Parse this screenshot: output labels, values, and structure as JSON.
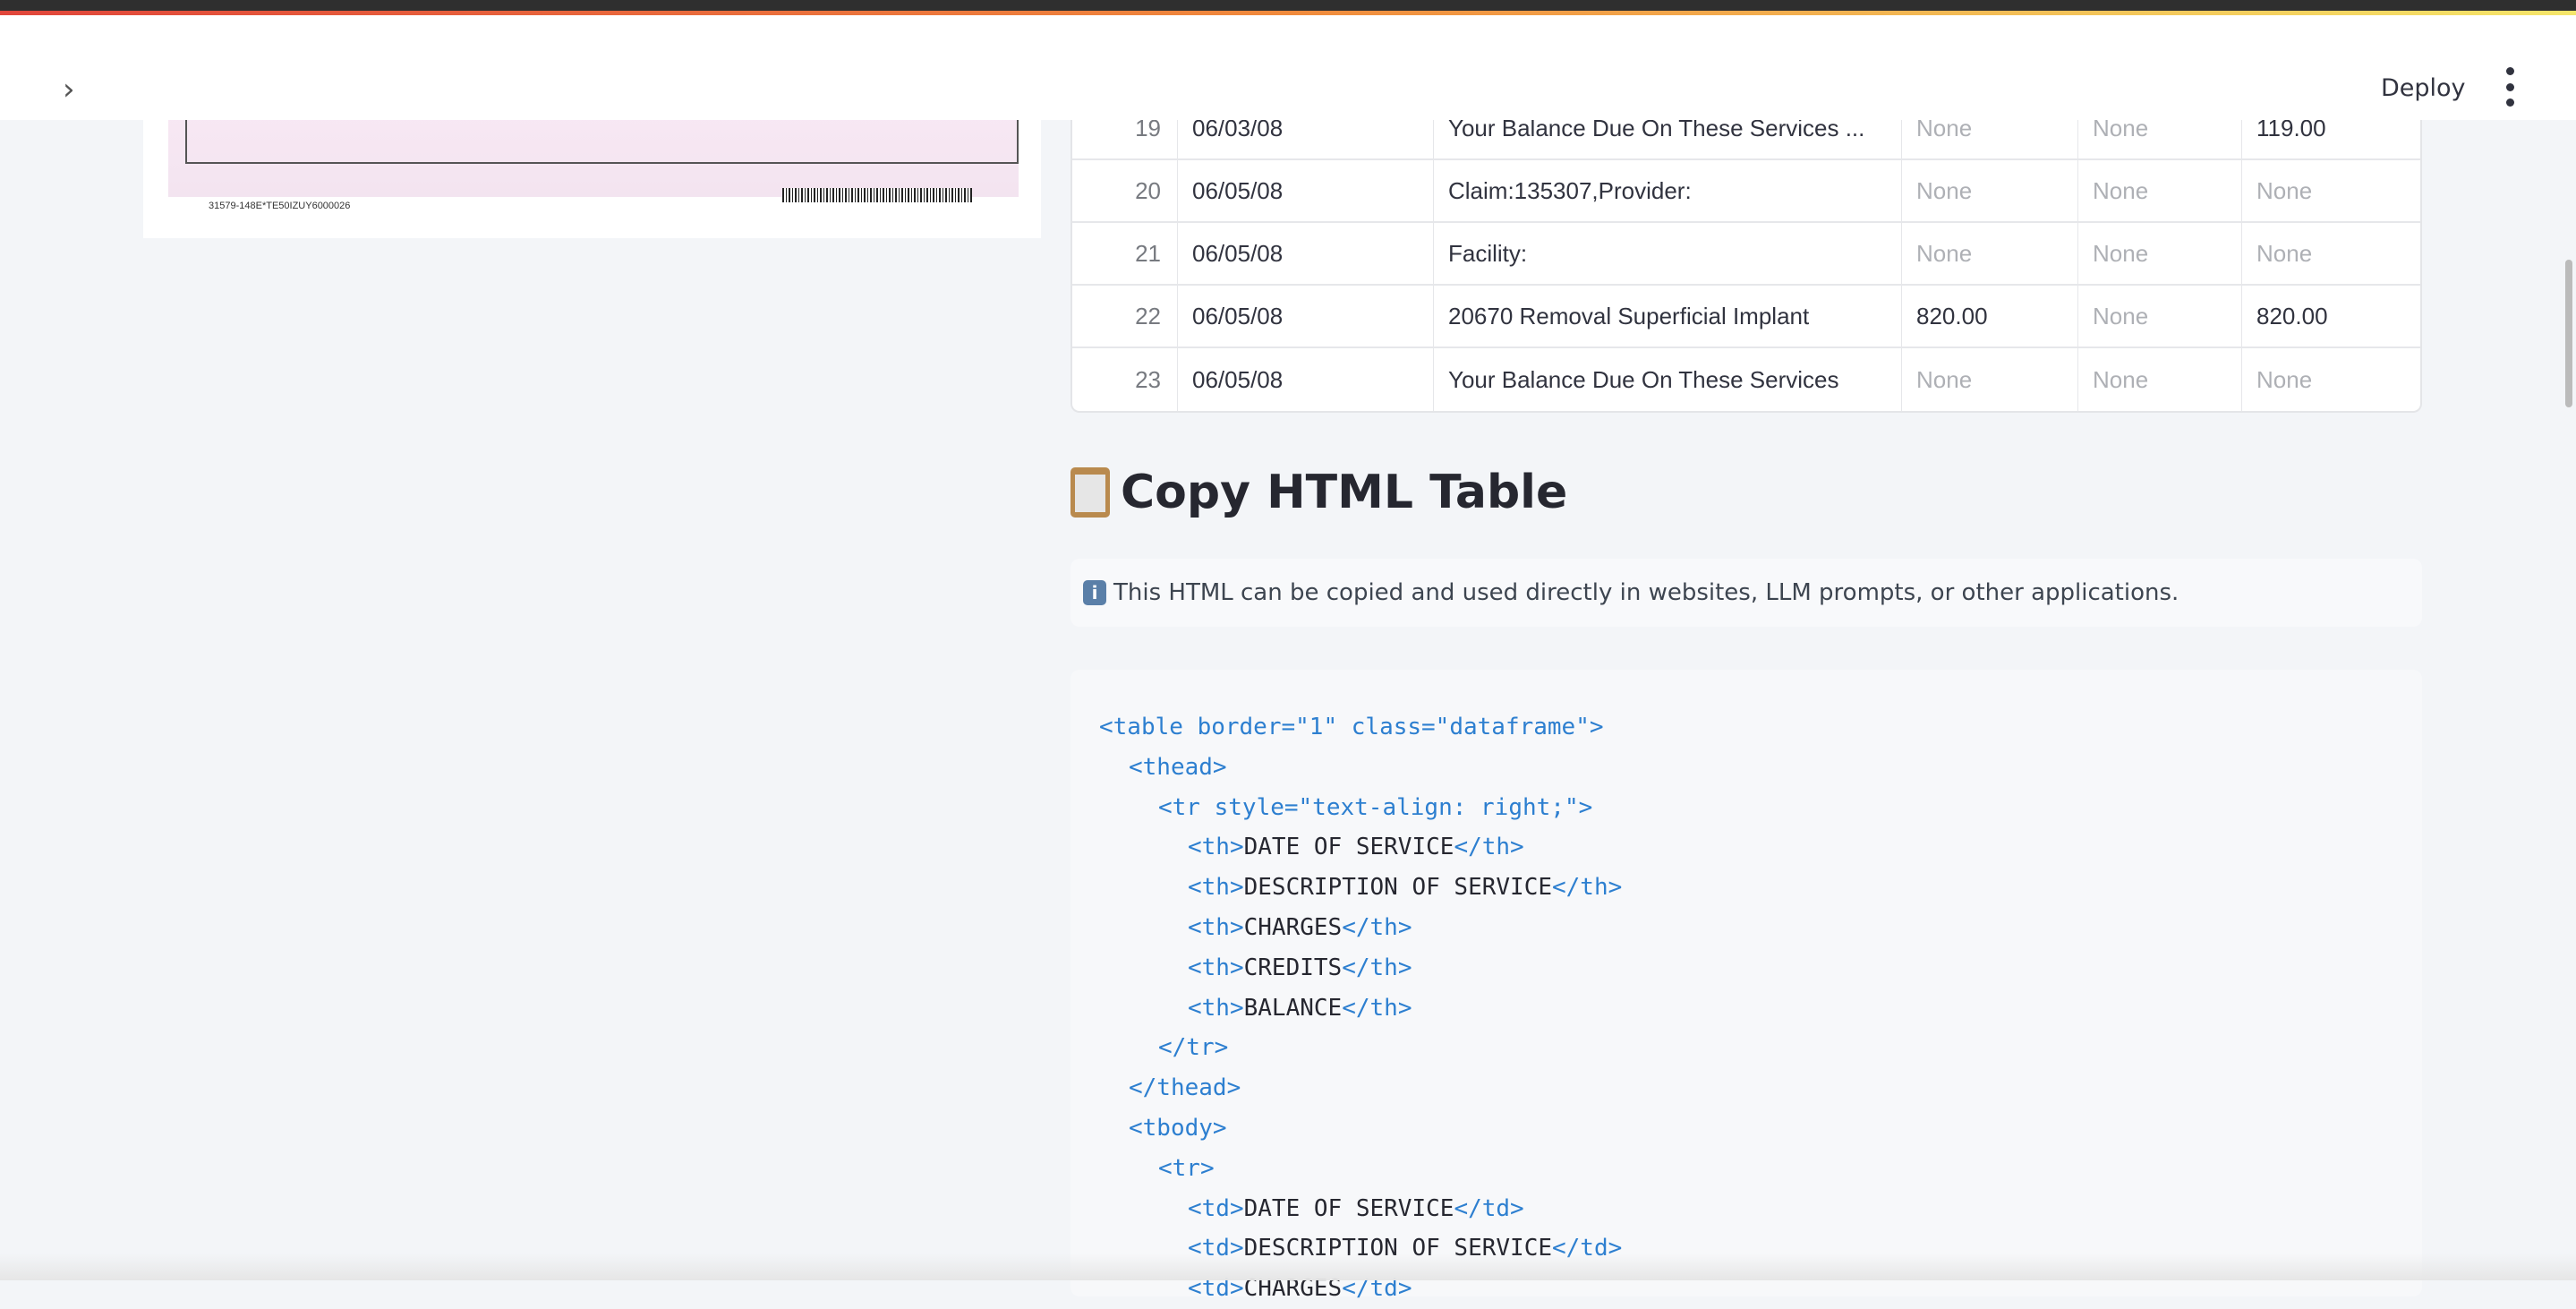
{
  "header": {
    "deploy_label": "Deploy"
  },
  "document_image": {
    "footer_code": "31579-148E*TE50IZUY6000026"
  },
  "table": {
    "rows": [
      {
        "index": "19",
        "date": "06/03/08",
        "description": "Your Balance Due On These Services ...",
        "charges": "None",
        "credits": "None",
        "balance": "119.00"
      },
      {
        "index": "20",
        "date": "06/05/08",
        "description": "Claim:135307,Provider:",
        "charges": "None",
        "credits": "None",
        "balance": "None"
      },
      {
        "index": "21",
        "date": "06/05/08",
        "description": "Facility:",
        "charges": "None",
        "credits": "None",
        "balance": "None"
      },
      {
        "index": "22",
        "date": "06/05/08",
        "description": "20670 Removal Superficial Implant",
        "charges": "820.00",
        "credits": "None",
        "balance": "820.00"
      },
      {
        "index": "23",
        "date": "06/05/08",
        "description": "Your Balance Due On These Services",
        "charges": "None",
        "credits": "None",
        "balance": "None"
      }
    ]
  },
  "section": {
    "title": "Copy HTML Table",
    "info": "This HTML can be copied and used directly in websites, LLM prompts, or other applications."
  },
  "code_lines": [
    {
      "indent": 0,
      "parts": [
        {
          "tag": "<table border=\"1\" class=\"dataframe\">"
        }
      ]
    },
    {
      "indent": 1,
      "parts": [
        {
          "tag": "<thead>"
        }
      ]
    },
    {
      "indent": 2,
      "parts": [
        {
          "tag": "<tr style=\"text-align: right;\">"
        }
      ]
    },
    {
      "indent": 3,
      "parts": [
        {
          "tag": "<th>"
        },
        {
          "txt": "DATE OF SERVICE"
        },
        {
          "tag": "</th>"
        }
      ]
    },
    {
      "indent": 3,
      "parts": [
        {
          "tag": "<th>"
        },
        {
          "txt": "DESCRIPTION OF SERVICE"
        },
        {
          "tag": "</th>"
        }
      ]
    },
    {
      "indent": 3,
      "parts": [
        {
          "tag": "<th>"
        },
        {
          "txt": "CHARGES"
        },
        {
          "tag": "</th>"
        }
      ]
    },
    {
      "indent": 3,
      "parts": [
        {
          "tag": "<th>"
        },
        {
          "txt": "CREDITS"
        },
        {
          "tag": "</th>"
        }
      ]
    },
    {
      "indent": 3,
      "parts": [
        {
          "tag": "<th>"
        },
        {
          "txt": "BALANCE"
        },
        {
          "tag": "</th>"
        }
      ]
    },
    {
      "indent": 2,
      "parts": [
        {
          "tag": "</tr>"
        }
      ]
    },
    {
      "indent": 1,
      "parts": [
        {
          "tag": "</thead>"
        }
      ]
    },
    {
      "indent": 1,
      "parts": [
        {
          "tag": "<tbody>"
        }
      ]
    },
    {
      "indent": 2,
      "parts": [
        {
          "tag": "<tr>"
        }
      ]
    },
    {
      "indent": 3,
      "parts": [
        {
          "tag": "<td>"
        },
        {
          "txt": "DATE OF SERVICE"
        },
        {
          "tag": "</td>"
        }
      ]
    },
    {
      "indent": 3,
      "parts": [
        {
          "tag": "<td>"
        },
        {
          "txt": "DESCRIPTION OF SERVICE"
        },
        {
          "tag": "</td>"
        }
      ]
    },
    {
      "indent": 3,
      "parts": [
        {
          "tag": "<td>"
        },
        {
          "txt": "CHARGES"
        },
        {
          "tag": "</td>"
        }
      ]
    }
  ]
}
